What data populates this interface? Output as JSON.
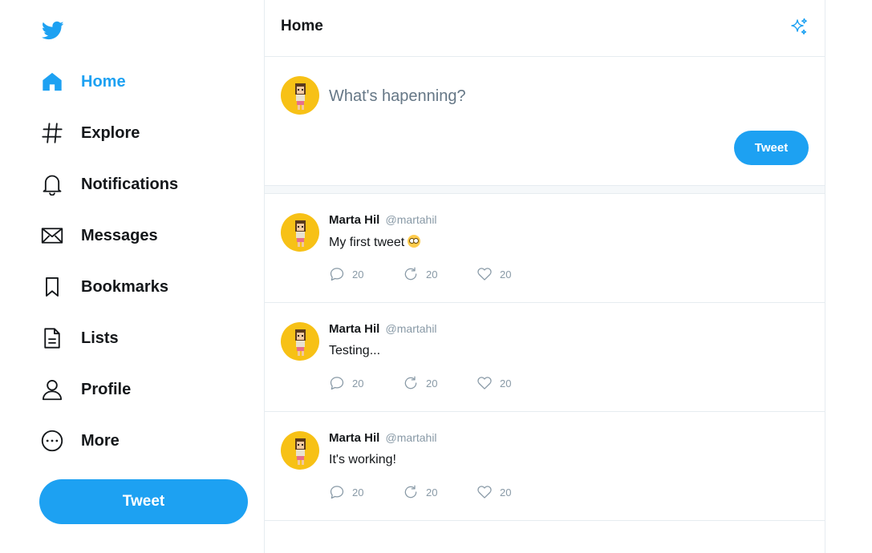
{
  "sidebar": {
    "logo_icon": "twitter-bird-icon",
    "items": [
      {
        "label": "Home",
        "icon": "home-icon"
      },
      {
        "label": "Explore",
        "icon": "hashtag-icon"
      },
      {
        "label": "Notifications",
        "icon": "bell-icon"
      },
      {
        "label": "Messages",
        "icon": "envelope-icon"
      },
      {
        "label": "Bookmarks",
        "icon": "bookmark-icon"
      },
      {
        "label": "Lists",
        "icon": "list-document-icon"
      },
      {
        "label": "Profile",
        "icon": "user-icon"
      },
      {
        "label": "More",
        "icon": "more-circle-icon"
      }
    ],
    "tweet_button": "Tweet"
  },
  "header": {
    "title": "Home",
    "top_tweets_icon": "sparkle-icon"
  },
  "composer": {
    "placeholder": "What's hapenning?",
    "tweet_button": "Tweet"
  },
  "tweets": [
    {
      "name": "Marta Hil",
      "handle": "@martahil",
      "text": "My first tweet",
      "emoji": "smiling-face-emoji",
      "replies": "20",
      "retweets": "20",
      "likes": "20"
    },
    {
      "name": "Marta Hil",
      "handle": "@martahil",
      "text": "Testing...",
      "replies": "20",
      "retweets": "20",
      "likes": "20"
    },
    {
      "name": "Marta Hil",
      "handle": "@martahil",
      "text": "It's working!",
      "replies": "20",
      "retweets": "20",
      "likes": "20"
    }
  ],
  "colors": {
    "accent": "#1da1f2",
    "text": "#14171a",
    "muted": "#8899a6",
    "border": "#e6ecf0",
    "avatar_bg": "#f7c116"
  }
}
